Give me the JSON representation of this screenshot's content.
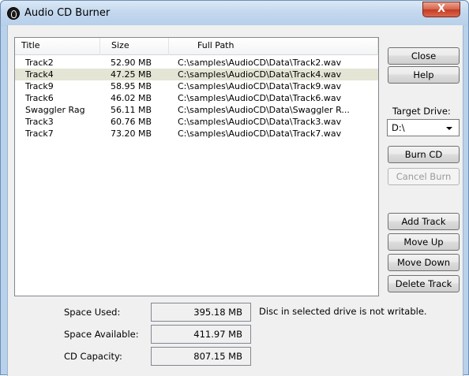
{
  "window": {
    "title": "Audio CD Burner",
    "close_glyph": "X",
    "app_icon": "audio-cd-icon"
  },
  "tracklist": {
    "columns": [
      "Title",
      "Size",
      "Full Path"
    ],
    "rows": [
      {
        "title": "Track2",
        "size": "52.90 MB",
        "path": "C:\\samples\\AudioCD\\Data\\Track2.wav",
        "selected": false
      },
      {
        "title": "Track4",
        "size": "47.25 MB",
        "path": "C:\\samples\\AudioCD\\Data\\Track4.wav",
        "selected": true
      },
      {
        "title": "Track9",
        "size": "58.95 MB",
        "path": "C:\\samples\\AudioCD\\Data\\Track9.wav",
        "selected": false
      },
      {
        "title": "Track6",
        "size": "46.02 MB",
        "path": "C:\\samples\\AudioCD\\Data\\Track6.wav",
        "selected": false
      },
      {
        "title": "Swaggler Rag",
        "size": "56.11 MB",
        "path": "C:\\samples\\AudioCD\\Data\\Swaggler R...",
        "selected": false
      },
      {
        "title": "Track3",
        "size": "60.76 MB",
        "path": "C:\\samples\\AudioCD\\Data\\Track3.wav",
        "selected": false
      },
      {
        "title": "Track7",
        "size": "73.20 MB",
        "path": "C:\\samples\\AudioCD\\Data\\Track7.wav",
        "selected": false
      }
    ]
  },
  "buttons": {
    "close": "Close",
    "help": "Help",
    "burn_cd": "Burn CD",
    "cancel_burn": "Cancel Burn",
    "add_track": "Add Track",
    "move_up": "Move Up",
    "move_down": "Move Down",
    "delete_track": "Delete Track"
  },
  "target_drive": {
    "label": "Target Drive:",
    "value": "D:\\"
  },
  "space": {
    "used_label": "Space Used:",
    "used_value": "395.18 MB",
    "available_label": "Space Available:",
    "available_value": "411.97 MB",
    "capacity_label": "CD Capacity:",
    "capacity_value": "807.15 MB"
  },
  "status_message": "Disc in selected drive is not writable.",
  "colors": {
    "selected_row": "#e5e5d6",
    "titlebar": "#c4d8ee",
    "close_button": "#c43b22"
  }
}
